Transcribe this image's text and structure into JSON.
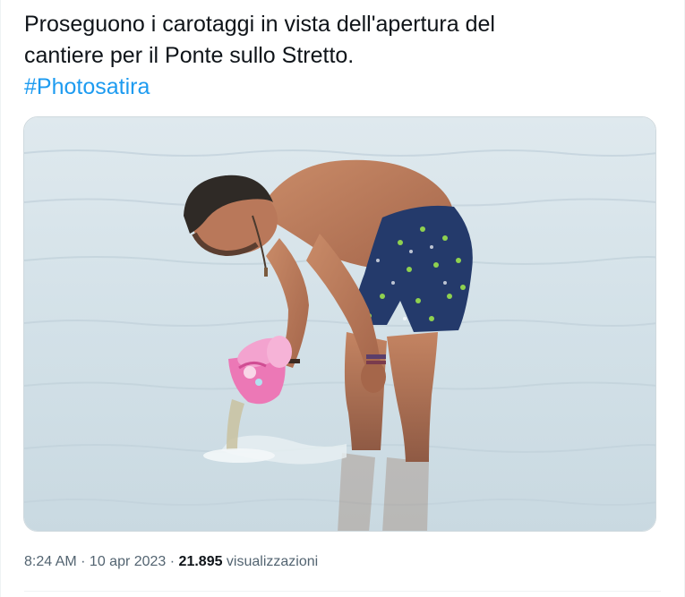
{
  "tweet": {
    "text_line1": "Proseguono i carotaggi in vista dell'apertura del",
    "text_line2": "cantiere per il Ponte sullo Stretto.",
    "hashtag": "#Photosatira"
  },
  "meta": {
    "time": "8:24 AM",
    "separator1": " · ",
    "date": "10 apr 2023",
    "separator2": " · ",
    "views_count": "21.895",
    "views_label": " visualizzazioni"
  },
  "colors": {
    "text": "#0f1419",
    "link": "#1d9bf0",
    "secondary": "#536471",
    "border": "#cfd9de",
    "water": "#d6e4ea"
  },
  "media": {
    "subject": "photo-man-bending-in-sea-pouring-water-from-pink-bucket"
  }
}
